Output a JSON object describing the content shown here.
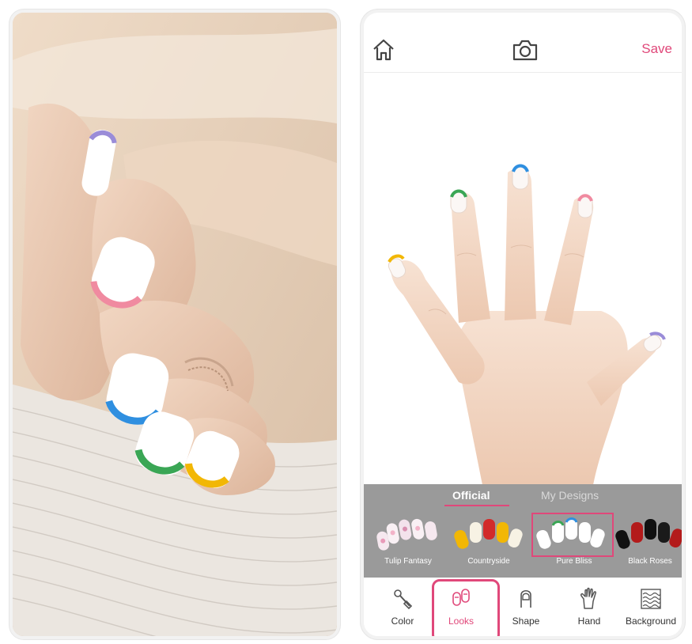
{
  "header": {
    "home_icon": "home-icon",
    "camera_icon": "camera-icon",
    "save_label": "Save"
  },
  "looks_panel": {
    "tabs": [
      {
        "label": "Official",
        "active": true
      },
      {
        "label": "My Designs",
        "active": false
      }
    ],
    "items": [
      {
        "label": "Tulip Fantasy",
        "selected": false
      },
      {
        "label": "Countryside",
        "selected": false
      },
      {
        "label": "Pure Bliss",
        "selected": true
      },
      {
        "label": "Black Roses",
        "selected": false
      }
    ]
  },
  "toolbar": {
    "items": [
      {
        "label": "Color",
        "icon": "nail-polish-icon",
        "active": false
      },
      {
        "label": "Looks",
        "icon": "nail-tips-icon",
        "active": true
      },
      {
        "label": "Shape",
        "icon": "nail-shape-icon",
        "active": false
      },
      {
        "label": "Hand",
        "icon": "hand-icon",
        "active": false
      },
      {
        "label": "Background",
        "icon": "waves-icon",
        "active": false
      }
    ]
  },
  "colors": {
    "accent": "#e0487a",
    "panel_bg": "#9a9a9a",
    "tip_yellow": "#f2b705",
    "tip_green": "#3aa655",
    "tip_blue": "#2f8fe0",
    "tip_pink": "#f08aa0",
    "tip_lavender": "#9a8cd8"
  }
}
